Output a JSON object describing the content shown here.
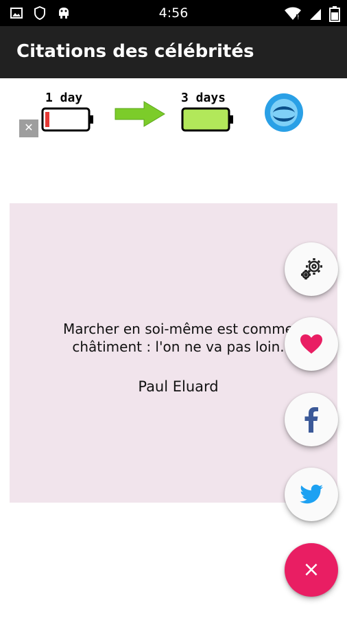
{
  "status_bar": {
    "time": "4:56",
    "left_icons": [
      "image-icon",
      "shield-icon",
      "android-icon"
    ],
    "right_icons": [
      "wifi-icon",
      "signal-icon",
      "battery-icon"
    ]
  },
  "app_bar": {
    "title": "Citations des célébrités"
  },
  "ad": {
    "label_left": "1 day",
    "label_right": "3 days",
    "close_label": "✕",
    "colors": {
      "battery_low": "#e53935",
      "battery_full": "#b2e85a",
      "arrow": "#7ccc2a"
    }
  },
  "quote": {
    "text": "Marcher en soi-même est comme\nchâtiment : l'on ne va pas loin.",
    "author": "Paul Eluard"
  },
  "fab_menu": {
    "items": [
      "settings",
      "favorite",
      "facebook",
      "twitter"
    ],
    "close_label": "×",
    "colors": {
      "heart": "#e91e63",
      "facebook": "#3b5998",
      "twitter": "#1da1f2",
      "close_bg": "#e91e63"
    }
  }
}
